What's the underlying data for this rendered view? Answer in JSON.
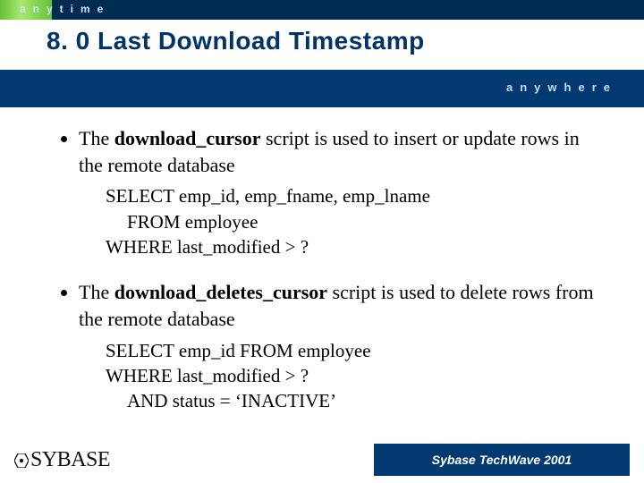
{
  "top": {
    "anytime": "anytime"
  },
  "title": "8. 0 Last Download Timestamp",
  "strip": {
    "anywhere": "anywhere"
  },
  "bullets": {
    "b1_pre": "The ",
    "b1_bold": "download_cursor",
    "b1_post": " script is used to insert or update rows in the remote database",
    "b2_pre": "The ",
    "b2_bold": "download_deletes_cursor",
    "b2_post": " script is used to delete rows from the remote database"
  },
  "code": {
    "c1_l1": "SELECT emp_id, emp_fname, emp_lname",
    "c1_l2": "FROM employee",
    "c1_l3": "WHERE last_modified > ?",
    "c2_l1": "SELECT emp_id FROM employee",
    "c2_l2": "WHERE last_modified > ?",
    "c2_l3": "    AND status = ‘INACTIVE’"
  },
  "footer": {
    "logo_text": "SYBASE",
    "techwave": "Sybase TechWave 2001"
  }
}
